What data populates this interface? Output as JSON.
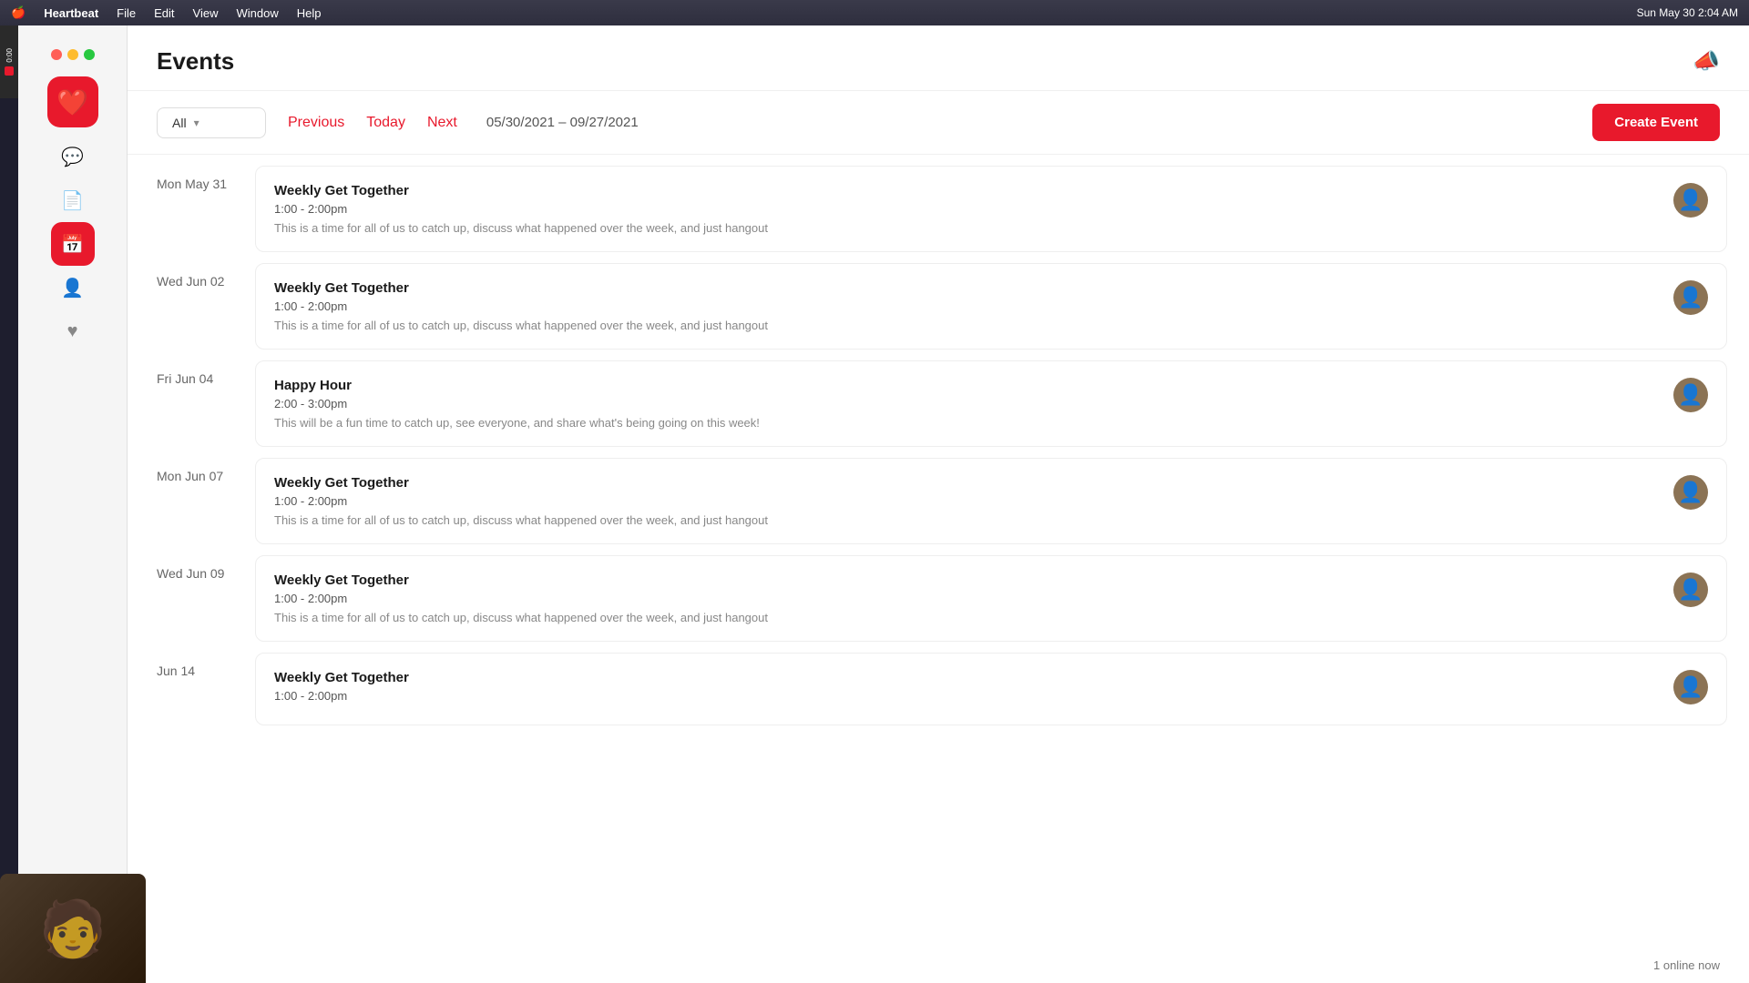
{
  "menubar": {
    "apple": "🍎",
    "app_name": "Heartbeat",
    "menus": [
      "File",
      "Edit",
      "View",
      "Window",
      "Help"
    ],
    "time": "Sun May 30  2:04 AM"
  },
  "sidebar": {
    "logo_icon": "❤️",
    "icons": [
      {
        "id": "messages",
        "symbol": "💬",
        "active": false
      },
      {
        "id": "notes",
        "symbol": "📄",
        "active": false
      },
      {
        "id": "events",
        "symbol": "📅",
        "active": true
      },
      {
        "id": "contacts",
        "symbol": "👤",
        "active": false
      },
      {
        "id": "favorites",
        "symbol": "♥",
        "active": false
      }
    ]
  },
  "page": {
    "title": "Events",
    "megaphone": "📣"
  },
  "toolbar": {
    "filter_label": "All",
    "filter_arrow": "▾",
    "previous_label": "Previous",
    "today_label": "Today",
    "next_label": "Next",
    "date_range": "05/30/2021 – 09/27/2021",
    "create_event_label": "Create Event"
  },
  "events": [
    {
      "day": "Mon May 31",
      "title": "Weekly Get Together",
      "time": "1:00 - 2:00pm",
      "desc": "This is a time for all of us to catch up, discuss what happened over the week, and just hangout"
    },
    {
      "day": "Wed Jun 02",
      "title": "Weekly Get Together",
      "time": "1:00 - 2:00pm",
      "desc": "This is a time for all of us to catch up, discuss what happened over the week, and just hangout"
    },
    {
      "day": "Fri Jun 04",
      "title": "Happy Hour",
      "time": "2:00 - 3:00pm",
      "desc": "This will be a fun time to catch up, see everyone, and share what's being going on this week!"
    },
    {
      "day": "Mon Jun 07",
      "title": "Weekly Get Together",
      "time": "1:00 - 2:00pm",
      "desc": "This is a time for all of us to catch up, discuss what happened over the week, and just hangout"
    },
    {
      "day": "Wed Jun 09",
      "title": "Weekly Get Together",
      "time": "1:00 - 2:00pm",
      "desc": "This is a time for all of us to catch up, discuss what happened over the week, and just hangout"
    },
    {
      "day": "Jun 14",
      "title": "Weekly Get Together",
      "time": "1:00 - 2:00pm",
      "desc": ""
    }
  ],
  "status": {
    "online_now": "1 online now"
  },
  "timer": {
    "time": "0:00"
  }
}
